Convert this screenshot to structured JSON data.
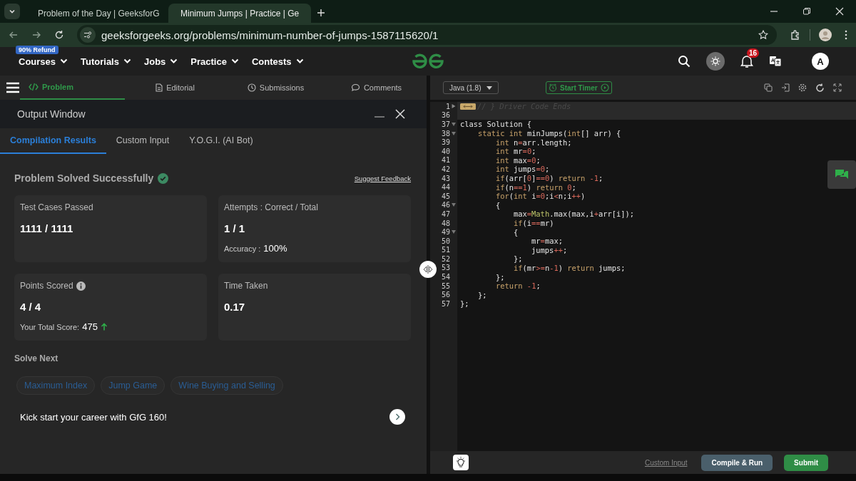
{
  "browser": {
    "tabs": [
      {
        "title": "Problem of the Day | GeeksforG",
        "selected": false
      },
      {
        "title": "Minimum Jumps | Practice | Ge",
        "selected": true
      }
    ],
    "url": "geeksforgeeks.org/problems/minimum-number-of-jumps-1587115620/1"
  },
  "nav": {
    "badge": "90% Refund",
    "items": [
      "Courses",
      "Tutorials",
      "Jobs",
      "Practice",
      "Contests"
    ],
    "notifications": "16",
    "avatar": "A"
  },
  "problem_tabs": [
    {
      "label": "Problem",
      "selected": true
    },
    {
      "label": "Editorial",
      "selected": false
    },
    {
      "label": "Submissions",
      "selected": false
    },
    {
      "label": "Comments",
      "selected": false
    }
  ],
  "output_window": {
    "title": "Output Window",
    "tabs": [
      {
        "label": "Compilation Results",
        "selected": true
      },
      {
        "label": "Custom Input",
        "selected": false
      },
      {
        "label": "Y.O.G.I. (AI Bot)",
        "selected": false
      }
    ],
    "status": "Problem Solved Successfully",
    "feedback_link": "Suggest Feedback",
    "cards": [
      {
        "title": "Test Cases Passed",
        "value": "1111 / 1111",
        "info_icon": false
      },
      {
        "title": "Attempts : Correct / Total",
        "value": "1 / 1",
        "info_icon": false,
        "note_label": "Accuracy :",
        "note_value": "100%",
        "rising": false
      },
      {
        "title": "Points Scored",
        "value": "4 / 4",
        "info_icon": true,
        "note_label": "Your Total Score:",
        "note_value": "475",
        "rising": true
      },
      {
        "title": "Time Taken",
        "value": "0.17",
        "info_icon": false
      }
    ],
    "solve_next_title": "Solve Next",
    "suggestions": [
      "Maximum Index",
      "Jump Game",
      "Wine Buying and Selling"
    ],
    "banner": "Kick start your career with GfG 160!"
  },
  "editor": {
    "language": "Java (1.8)",
    "timer_button": "Start Timer",
    "lines": [
      {
        "number": "1",
        "foldable": true,
        "folded": true,
        "highlighted": true,
        "text": "// } Driver Code Ends"
      },
      {
        "number": "36",
        "foldable": false,
        "folded": false,
        "highlighted": true
      },
      {
        "number": "37",
        "foldable": true,
        "folded": false,
        "highlighted": false,
        "text": "class Solution {"
      },
      {
        "number": "38",
        "foldable": true,
        "folded": false,
        "highlighted": false,
        "text": "    static int minJumps(int[] arr) {"
      },
      {
        "number": "39",
        "foldable": false,
        "folded": false,
        "highlighted": false,
        "text": "        int n=arr.length;"
      },
      {
        "number": "40",
        "foldable": false,
        "folded": false,
        "highlighted": false,
        "text": "        int mr=0;"
      },
      {
        "number": "41",
        "foldable": false,
        "folded": false,
        "highlighted": false,
        "text": "        int max=0;"
      },
      {
        "number": "42",
        "foldable": false,
        "folded": false,
        "highlighted": false,
        "text": "        int jumps=0;"
      },
      {
        "number": "43",
        "foldable": false,
        "folded": false,
        "highlighted": false,
        "text": "        if(arr[0]==0) return -1;"
      },
      {
        "number": "44",
        "foldable": false,
        "folded": false,
        "highlighted": false,
        "text": "        if(n==1) return 0;"
      },
      {
        "number": "45",
        "foldable": false,
        "folded": false,
        "highlighted": false,
        "text": "        for(int i=0;i<n;i++)"
      },
      {
        "number": "46",
        "foldable": true,
        "folded": false,
        "highlighted": false,
        "text": "        {"
      },
      {
        "number": "47",
        "foldable": false,
        "folded": false,
        "highlighted": false,
        "text": "            max=Math.max(max,i+arr[i]);"
      },
      {
        "number": "48",
        "foldable": false,
        "folded": false,
        "highlighted": false,
        "text": "            if(i==mr)"
      },
      {
        "number": "49",
        "foldable": true,
        "folded": false,
        "highlighted": false,
        "text": "            {"
      },
      {
        "number": "50",
        "foldable": false,
        "folded": false,
        "highlighted": false,
        "text": "                mr=max;"
      },
      {
        "number": "51",
        "foldable": false,
        "folded": false,
        "highlighted": false,
        "text": "                jumps++;"
      },
      {
        "number": "52",
        "foldable": false,
        "folded": false,
        "highlighted": false,
        "text": "            };"
      },
      {
        "number": "53",
        "foldable": false,
        "folded": false,
        "highlighted": false,
        "text": "            if(mr>=n-1) return jumps;"
      },
      {
        "number": "54",
        "foldable": false,
        "folded": false,
        "highlighted": false,
        "text": "        };"
      },
      {
        "number": "55",
        "foldable": false,
        "folded": false,
        "highlighted": false,
        "text": "        return -1;"
      },
      {
        "number": "56",
        "foldable": false,
        "folded": false,
        "highlighted": false,
        "text": "    };"
      },
      {
        "number": "57",
        "foldable": false,
        "folded": false,
        "highlighted": false,
        "text": "};"
      }
    ]
  },
  "footer": {
    "custom_input": "Custom Input",
    "compile": "Compile & Run",
    "submit": "Submit"
  }
}
